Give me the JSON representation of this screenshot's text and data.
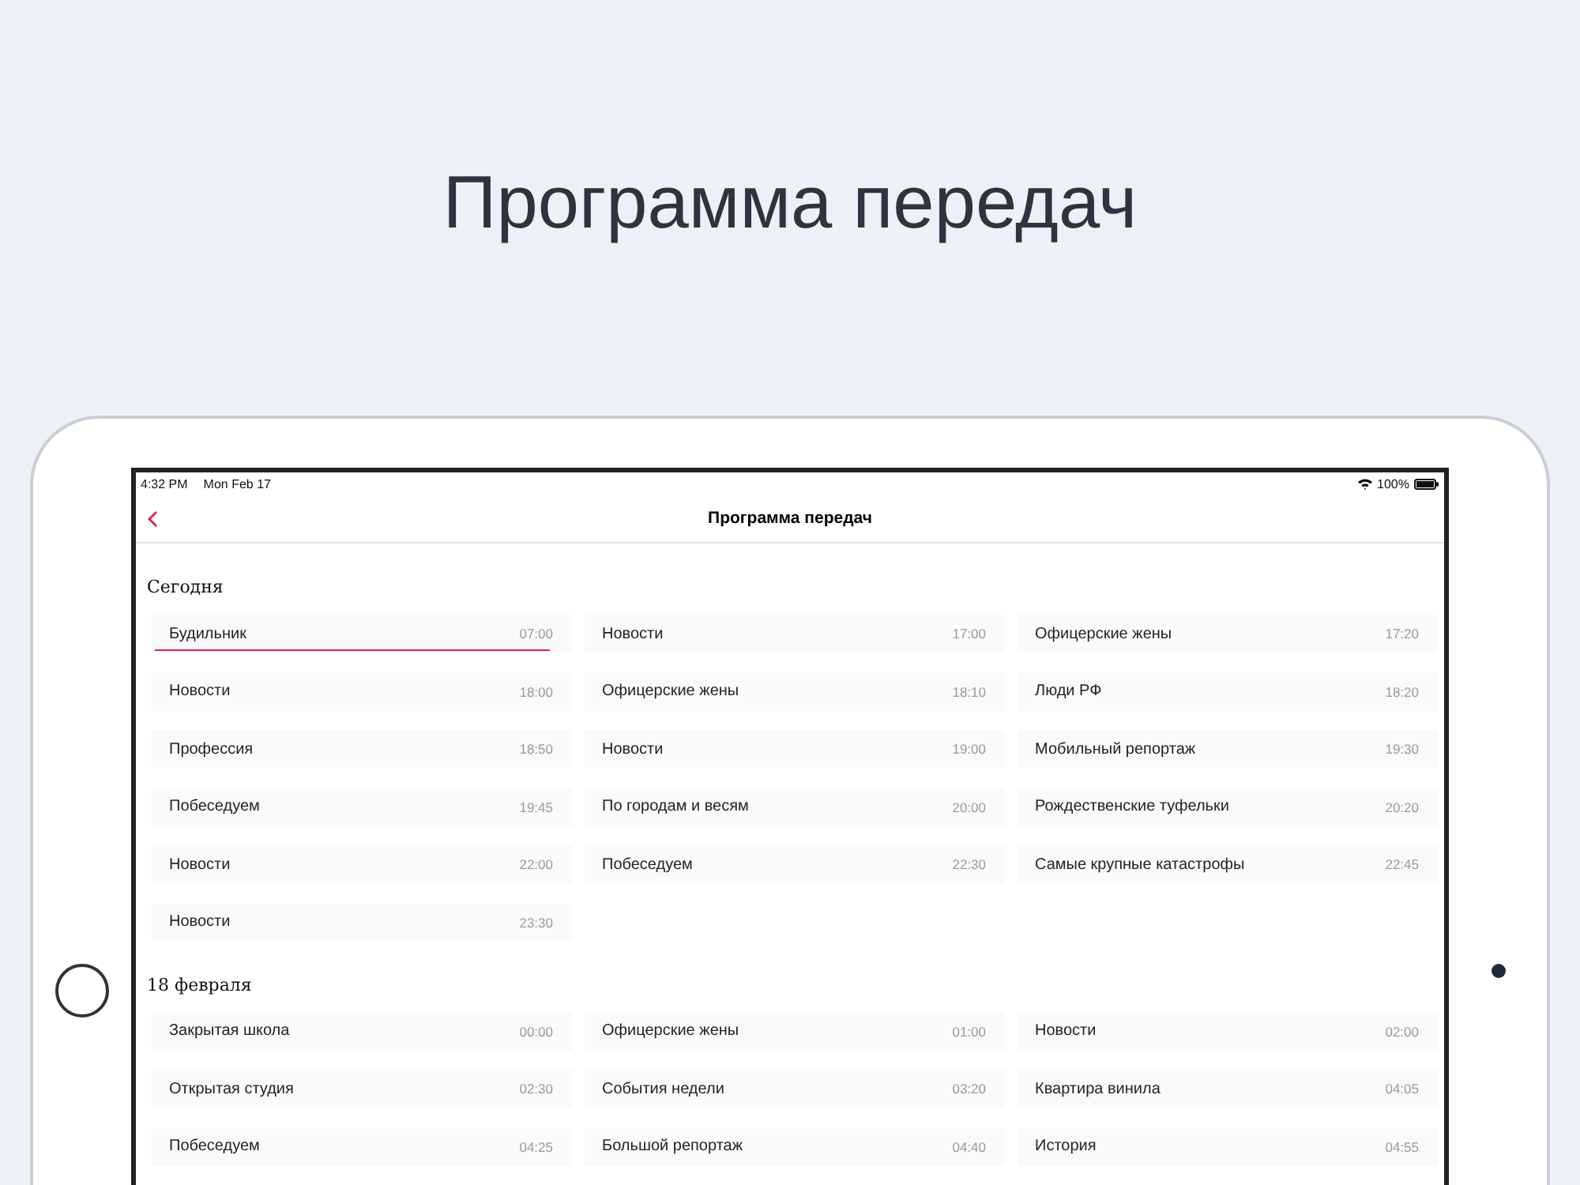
{
  "headline": "Программа передач",
  "status_bar": {
    "time": "4:32 PM",
    "date": "Mon Feb 17",
    "battery": "100%"
  },
  "nav_bar": {
    "title": "Программа передач"
  },
  "sections": [
    {
      "title": "Сегодня",
      "items": [
        {
          "name": "Будильник",
          "time": "07:00",
          "selected": true
        },
        {
          "name": "Новости",
          "time": "17:00",
          "selected": false
        },
        {
          "name": "Офицерские жены",
          "time": "17:20",
          "selected": false
        },
        {
          "name": "Новости",
          "time": "18:00",
          "selected": false
        },
        {
          "name": "Офицерские жены",
          "time": "18:10",
          "selected": false
        },
        {
          "name": "Люди РФ",
          "time": "18:20",
          "selected": false
        },
        {
          "name": "Профессия",
          "time": "18:50",
          "selected": false
        },
        {
          "name": "Новости",
          "time": "19:00",
          "selected": false
        },
        {
          "name": "Мобильный репортаж",
          "time": "19:30",
          "selected": false
        },
        {
          "name": "Побеседуем",
          "time": "19:45",
          "selected": false
        },
        {
          "name": "По городам и весям",
          "time": "20:00",
          "selected": false
        },
        {
          "name": "Рождественские туфельки",
          "time": "20:20",
          "selected": false
        },
        {
          "name": "Новости",
          "time": "22:00",
          "selected": false
        },
        {
          "name": "Побеседуем",
          "time": "22:30",
          "selected": false
        },
        {
          "name": "Самые крупные катастрофы",
          "time": "22:45",
          "selected": false
        },
        {
          "name": "Новости",
          "time": "23:30",
          "selected": false
        }
      ]
    },
    {
      "title": "18 февраля",
      "items": [
        {
          "name": "Закрытая школа",
          "time": "00:00",
          "selected": false
        },
        {
          "name": "Офицерские жены",
          "time": "01:00",
          "selected": false
        },
        {
          "name": "Новости",
          "time": "02:00",
          "selected": false
        },
        {
          "name": "Открытая студия",
          "time": "02:30",
          "selected": false
        },
        {
          "name": "События недели",
          "time": "03:20",
          "selected": false
        },
        {
          "name": "Квартира винила",
          "time": "04:05",
          "selected": false
        },
        {
          "name": "Побеседуем",
          "time": "04:25",
          "selected": false
        },
        {
          "name": "Большой репортаж",
          "time": "04:40",
          "selected": false
        },
        {
          "name": "История",
          "time": "04:55",
          "selected": false
        }
      ]
    }
  ]
}
